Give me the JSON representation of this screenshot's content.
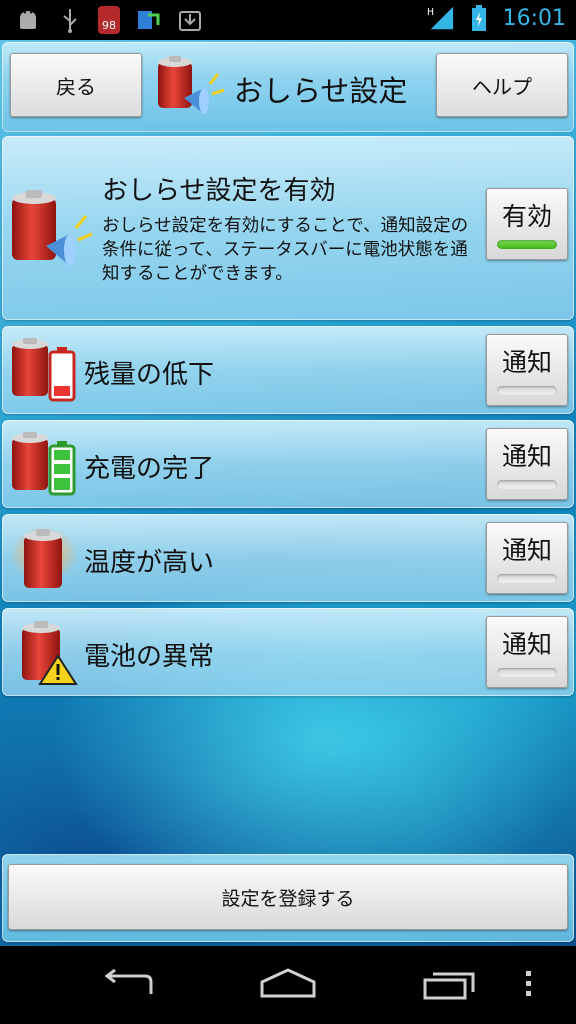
{
  "status_bar": {
    "left_icons": [
      "android-debug-icon",
      "usb-icon",
      "battery-app-icon",
      "sync-icon",
      "download-icon"
    ],
    "battery_app_badge": "98",
    "network": "H",
    "time": "16:01",
    "time_color": "#33b5e5"
  },
  "header": {
    "back_label": "戻る",
    "title": "おしらせ設定",
    "help_label": "ヘルプ"
  },
  "master": {
    "title": "おしらせ設定を有効",
    "description": "おしらせ設定を有効にすることで、通知設定の条件に従って、ステータスバーに電池状態を通知することができます。",
    "toggle_label": "有効",
    "enabled": true
  },
  "notifications": [
    {
      "label": "残量の低下",
      "toggle_label": "通知",
      "enabled": false,
      "icon": "battery-low-icon"
    },
    {
      "label": "充電の完了",
      "toggle_label": "通知",
      "enabled": false,
      "icon": "battery-full-icon"
    },
    {
      "label": "温度が高い",
      "toggle_label": "通知",
      "enabled": false,
      "icon": "battery-hot-icon"
    },
    {
      "label": "電池の異常",
      "toggle_label": "通知",
      "enabled": false,
      "icon": "battery-warning-icon"
    }
  ],
  "footer": {
    "register_label": "設定を登録する"
  },
  "colors": {
    "toggle_on": "#3fb21a",
    "battery_red": "#c8261e"
  }
}
